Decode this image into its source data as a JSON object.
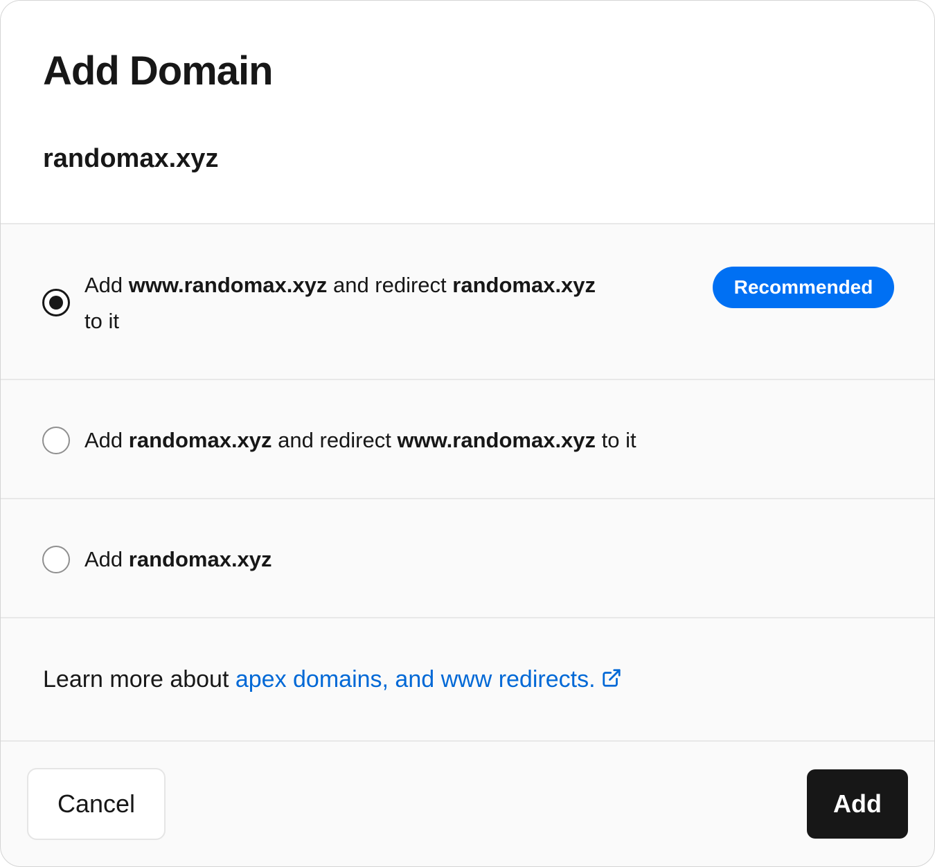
{
  "dialog": {
    "title": "Add Domain",
    "domain": "randomax.xyz"
  },
  "options": [
    {
      "prefix": "Add ",
      "bold1": "www.randomax.xyz",
      "middle": " and redirect ",
      "bold2": "randomax.xyz",
      "suffix": " to it",
      "badge": "Recommended",
      "selected": true
    },
    {
      "prefix": "Add ",
      "bold1": "randomax.xyz",
      "middle": " and redirect ",
      "bold2": "www.randomax.xyz",
      "suffix": " to it",
      "selected": false
    },
    {
      "prefix": "Add ",
      "bold1": "randomax.xyz",
      "selected": false
    }
  ],
  "learn_more": {
    "text": "Learn more about ",
    "link": "apex domains, and www redirects.",
    "icon": "external-link-icon"
  },
  "footer": {
    "cancel_label": "Cancel",
    "add_label": "Add"
  },
  "colors": {
    "accent": "#0070f3",
    "link": "#0068d6",
    "primary_button": "#171717"
  }
}
